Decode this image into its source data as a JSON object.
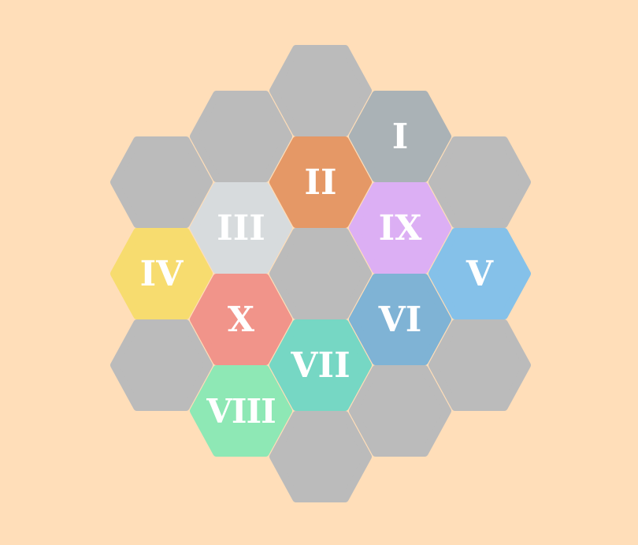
{
  "board": {
    "background": "#FFDEB9",
    "empty_color": "#BBBBBB",
    "label_color": "#FFFFFF",
    "cells": [
      {
        "col": 2,
        "row": 0,
        "label": "",
        "color": "#BBBBBB"
      },
      {
        "col": 1,
        "row": 1,
        "label": "",
        "color": "#BBBBBB"
      },
      {
        "col": 3,
        "row": 1,
        "label": "I",
        "color": "#AAB2B6"
      },
      {
        "col": 0,
        "row": 2,
        "label": "",
        "color": "#BBBBBB"
      },
      {
        "col": 2,
        "row": 2,
        "label": "II",
        "color": "#E59866"
      },
      {
        "col": 4,
        "row": 2,
        "label": "",
        "color": "#BBBBBB"
      },
      {
        "col": 1,
        "row": 3,
        "label": "III",
        "color": "#D7DBDD"
      },
      {
        "col": 3,
        "row": 3,
        "label": "IX",
        "color": "#DCAFF4"
      },
      {
        "col": 0,
        "row": 4,
        "label": "IV",
        "color": "#F7DC6F"
      },
      {
        "col": 2,
        "row": 4,
        "label": "",
        "color": "#BBBBBB"
      },
      {
        "col": 4,
        "row": 4,
        "label": "V",
        "color": "#85C1E9"
      },
      {
        "col": 1,
        "row": 5,
        "label": "X",
        "color": "#F1948A"
      },
      {
        "col": 3,
        "row": 5,
        "label": "VI",
        "color": "#7FB3D5"
      },
      {
        "col": 0,
        "row": 6,
        "label": "",
        "color": "#BBBBBB"
      },
      {
        "col": 2,
        "row": 6,
        "label": "VII",
        "color": "#76D7C4"
      },
      {
        "col": 4,
        "row": 6,
        "label": "",
        "color": "#BBBBBB"
      },
      {
        "col": 1,
        "row": 7,
        "label": "VIII",
        "color": "#8EE8B5"
      },
      {
        "col": 3,
        "row": 7,
        "label": "",
        "color": "#BBBBBB"
      },
      {
        "col": 2,
        "row": 8,
        "label": "",
        "color": "#BBBBBB"
      }
    ]
  }
}
